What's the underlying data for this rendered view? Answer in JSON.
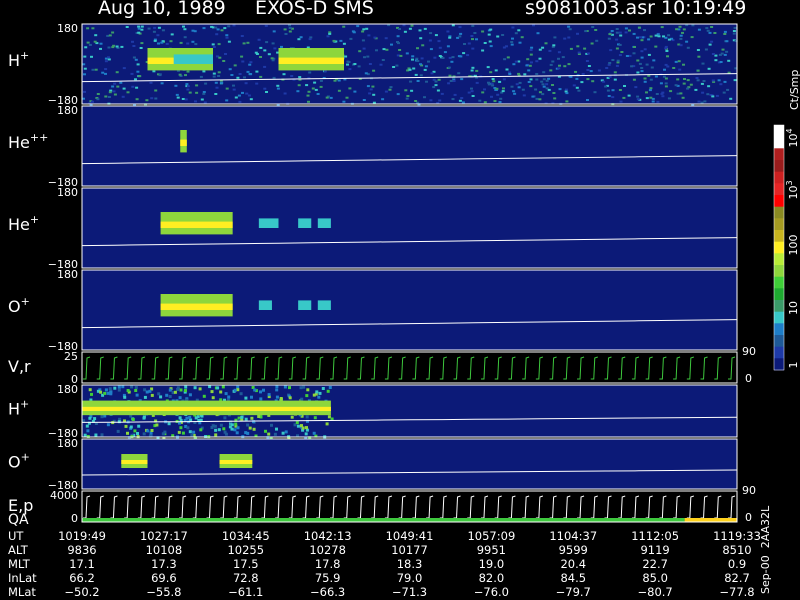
{
  "header": {
    "date": "Aug 10, 1989",
    "instrument": "EXOS-D SMS",
    "file": "s9081003.asr",
    "time": "10:19:49"
  },
  "colors": {
    "background": "#000000",
    "panel_fill": "#0c1a78",
    "trace": "#ffffff",
    "overlay_green": "#3ec83e",
    "qa_bar_green": "#3ec83e",
    "qa_bar_yellow": "#ffd21e"
  },
  "chart_data": {
    "type": "heatmap",
    "x_axis_label": "UT",
    "time_tick_labels": [
      "1019:49",
      "1027:17",
      "1034:45",
      "1042:13",
      "1049:41",
      "1057:09",
      "1104:37",
      "1112:05",
      "1119:33"
    ],
    "panels": [
      {
        "key": "H+ top",
        "label": "H",
        "sup": "+",
        "ytop": "180",
        "ybottom": "−180",
        "right_top": "",
        "right_bottom": "",
        "bright_segments": [
          [
            0.1,
            0.2
          ],
          [
            0.3,
            0.4
          ]
        ],
        "extra_segments": [
          [
            0.14,
            0.2
          ]
        ]
      },
      {
        "key": "He++",
        "label": "He",
        "sup": "++",
        "ytop": "180",
        "ybottom": "−180",
        "right_top": "",
        "right_bottom": "",
        "bright_segments": [
          [
            0.15,
            0.16
          ]
        ],
        "extra_segments": []
      },
      {
        "key": "He+",
        "label": "He",
        "sup": "+",
        "ytop": "180",
        "ybottom": "−180",
        "right_top": "",
        "right_bottom": "",
        "bright_segments": [
          [
            0.12,
            0.23
          ]
        ],
        "extra_segments": [
          [
            0.27,
            0.3
          ],
          [
            0.33,
            0.35
          ],
          [
            0.36,
            0.38
          ]
        ]
      },
      {
        "key": "O+",
        "label": "O",
        "sup": "+",
        "ytop": "180",
        "ybottom": "−180",
        "right_top": "",
        "right_bottom": "",
        "bright_segments": [
          [
            0.12,
            0.23
          ]
        ],
        "extra_segments": [
          [
            0.27,
            0.29
          ],
          [
            0.33,
            0.35
          ],
          [
            0.36,
            0.38
          ]
        ]
      },
      {
        "key": "V,r",
        "label": "V,r",
        "sup": "",
        "ytop": "25",
        "ybottom": "0",
        "right_top": "90",
        "right_bottom": "0",
        "bright_segments": [],
        "extra_segments": []
      },
      {
        "key": "H+ second",
        "label": "H",
        "sup": "+",
        "ytop": "180",
        "ybottom": "−180",
        "right_top": "",
        "right_bottom": "",
        "bright_segments": [
          [
            0.0,
            0.38
          ]
        ],
        "extra_segments": []
      },
      {
        "key": "O+ second",
        "label": "O",
        "sup": "+",
        "ytop": "180",
        "ybottom": "−180",
        "right_top": "",
        "right_bottom": "",
        "bright_segments": [
          [
            0.06,
            0.1
          ],
          [
            0.21,
            0.26
          ]
        ],
        "extra_segments": []
      },
      {
        "key": "E,p QA",
        "label": "E,p",
        "sup": "",
        "extra_label": "QA",
        "ytop": "4000",
        "ybottom": "0",
        "right_top": "90",
        "right_bottom": "0",
        "bright_segments": [],
        "extra_segments": []
      }
    ],
    "colorbar": {
      "title": "Ct/Smp",
      "tick_labels": [
        {
          "base": "10",
          "exp": "4"
        },
        {
          "base": "10",
          "exp": "3"
        },
        {
          "base": "100",
          "exp": ""
        },
        {
          "base": "10",
          "exp": ""
        },
        {
          "base": "1",
          "exp": ""
        }
      ],
      "colors": [
        "#ffffff",
        "#ffffff",
        "#b01f1f",
        "#981c1c",
        "#cc2020",
        "#e52525",
        "#ff0000",
        "#8a8a22",
        "#a59b22",
        "#c8b41e",
        "#ffee22",
        "#b8ec38",
        "#8ed63c",
        "#3fcf38",
        "#1eaa30",
        "#3b9b6a",
        "#38c8c8",
        "#1e7ec8",
        "#1e5a98",
        "#1e3aa8",
        "#0c1a78"
      ]
    },
    "footer_rows": [
      {
        "label": "UT",
        "values": [
          "1019:49",
          "1027:17",
          "1034:45",
          "1042:13",
          "1049:41",
          "1057:09",
          "1104:37",
          "1112:05",
          "1119:33"
        ]
      },
      {
        "label": "ALT",
        "values": [
          "9836",
          "10108",
          "10255",
          "10278",
          "10177",
          "9951",
          "9599",
          "9119",
          "8510"
        ]
      },
      {
        "label": "MLT",
        "values": [
          "17.1",
          "17.3",
          "17.5",
          "17.8",
          "18.3",
          "19.0",
          "20.4",
          "22.7",
          "0.9"
        ]
      },
      {
        "label": "InLat",
        "values": [
          "66.2",
          "69.6",
          "72.8",
          "75.9",
          "79.0",
          "82.0",
          "84.5",
          "85.0",
          "82.7"
        ]
      },
      {
        "label": "MLat",
        "values": [
          "−50.2",
          "−55.8",
          "−61.1",
          "−66.3",
          "−71.3",
          "−76.0",
          "−79.7",
          "−80.7",
          "−77.8"
        ]
      }
    ],
    "footnote": "Sep-00  2AA32L"
  }
}
